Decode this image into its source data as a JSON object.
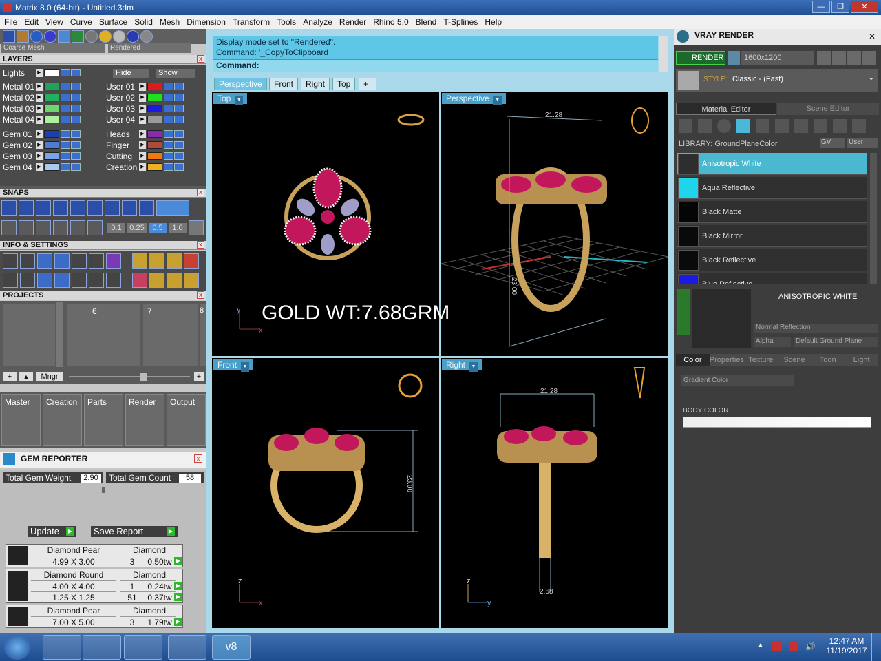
{
  "window": {
    "title": "Matrix 8.0 (64-bit) - Untitled.3dm",
    "min": "—",
    "max": "❐",
    "close": "✕"
  },
  "menu": [
    "File",
    "Edit",
    "View",
    "Curve",
    "Surface",
    "Solid",
    "Mesh",
    "Dimension",
    "Transform",
    "Tools",
    "Analyze",
    "Render",
    "Rhino 5.0",
    "Blend",
    "T-Splines",
    "Help"
  ],
  "toolbar": {
    "mesh_mode": "Coarse Mesh",
    "display_mode": "Rendered"
  },
  "layers": {
    "title": "LAYERS",
    "lights": "Lights",
    "hide": "Hide",
    "show": "Show",
    "left": [
      {
        "name": "Metal 01",
        "color": "#1fa35a"
      },
      {
        "name": "Metal 02",
        "color": "#22b15e"
      },
      {
        "name": "Metal 03",
        "color": "#6fd66f"
      },
      {
        "name": "Metal 04",
        "color": "#aef0a0"
      },
      {
        "name": "Gem 01",
        "color": "#1a3fb0"
      },
      {
        "name": "Gem 02",
        "color": "#4f7bd8"
      },
      {
        "name": "Gem 03",
        "color": "#7aa4ea"
      },
      {
        "name": "Gem 04",
        "color": "#a9c8f2"
      }
    ],
    "right": [
      {
        "name": "User 01",
        "color": "#e01a1a"
      },
      {
        "name": "User 02",
        "color": "#1ee01e"
      },
      {
        "name": "User 03",
        "color": "#1a1ae0"
      },
      {
        "name": "User 04",
        "color": "#9a9a9a"
      },
      {
        "name": "Heads",
        "color": "#8a2ab0"
      },
      {
        "name": "Finger",
        "color": "#b04a3a"
      },
      {
        "name": "Cutting",
        "color": "#f07a10"
      },
      {
        "name": "Creation",
        "color": "#f0b020"
      }
    ]
  },
  "snaps": {
    "title": "SNAPS",
    "values": [
      "0.1",
      "0.25",
      "0.5",
      "1.0"
    ]
  },
  "info": {
    "title": "INFO & SETTINGS"
  },
  "projects": {
    "title": "PROJECTS",
    "slots": [
      "6",
      "7",
      "8"
    ],
    "mngr": "Mngr",
    "tabs": [
      "Master",
      "Creation",
      "Parts",
      "Render",
      "Output"
    ]
  },
  "gem_reporter": {
    "title": "GEM REPORTER",
    "total_weight_label": "Total Gem Weight",
    "total_weight": "2.90",
    "total_count_label": "Total Gem Count",
    "total_count": "58",
    "update": "Update",
    "save": "Save Report",
    "groups": [
      {
        "shape": "Diamond Pear",
        "type": "Diamond",
        "rows": [
          {
            "size": "4.99 X 3.00",
            "qty": "3",
            "wt": "0.50tw"
          }
        ]
      },
      {
        "shape": "Diamond Round",
        "type": "Diamond",
        "rows": [
          {
            "size": "4.00 X 4.00",
            "qty": "1",
            "wt": "0.24tw"
          },
          {
            "size": "1.25 X 1.25",
            "qty": "51",
            "wt": "0.37tw"
          }
        ]
      },
      {
        "shape": "Diamond Pear",
        "type": "Diamond",
        "rows": [
          {
            "size": "7.00 X 5.00",
            "qty": "3",
            "wt": "1.79tw"
          }
        ]
      }
    ]
  },
  "command": {
    "line1": "Display mode set to \"Rendered\".",
    "line2": "Command: '_CopyToClipboard",
    "prompt": "Command:"
  },
  "view_tabs": [
    "Perspective",
    "Front",
    "Right",
    "Top",
    "+"
  ],
  "viewports": {
    "top": {
      "label": "Top"
    },
    "perspective": {
      "label": "Perspective",
      "dim1": "21.28",
      "dim2": "23.00"
    },
    "front": {
      "label": "Front",
      "dim": "23.00"
    },
    "right": {
      "label": "Right",
      "dim1": "21.28",
      "dim2": "2.68"
    },
    "overlay": "GOLD WT:7.68GRM"
  },
  "vray": {
    "title": "VRAY RENDER",
    "render": "RENDER",
    "resolution": "1600x1200",
    "style_label": "STYLE:",
    "style": "Classic - (Fast)",
    "tabs": [
      "Material Editor",
      "Scene Editor"
    ],
    "library": "LIBRARY: GroundPlaneColor",
    "gv": "GV",
    "user": "User",
    "materials": [
      {
        "name": "Anisotropic White",
        "color": "#2e2e2e"
      },
      {
        "name": "Aqua Reflective",
        "color": "#20d4ea"
      },
      {
        "name": "Black Matte",
        "color": "#050505"
      },
      {
        "name": "Black Mirror",
        "color": "#0a0a0a"
      },
      {
        "name": "Black Reflective",
        "color": "#0a0a0a"
      },
      {
        "name": "Blue Reflective",
        "color": "#1a1ae0"
      }
    ],
    "preview_title": "ANISOTROPIC WHITE",
    "reflection": "Normal Reflection",
    "alpha": "Alpha",
    "ground": "Default Ground Plane",
    "prop_tabs": [
      "Color",
      "Properties",
      "Texture",
      "Scene",
      "Toon",
      "Light"
    ],
    "gradient": "Gradient Color",
    "body_color": "BODY COLOR"
  },
  "taskbar": {
    "time": "12:47 AM",
    "date": "11/19/2017",
    "app": "v8"
  }
}
